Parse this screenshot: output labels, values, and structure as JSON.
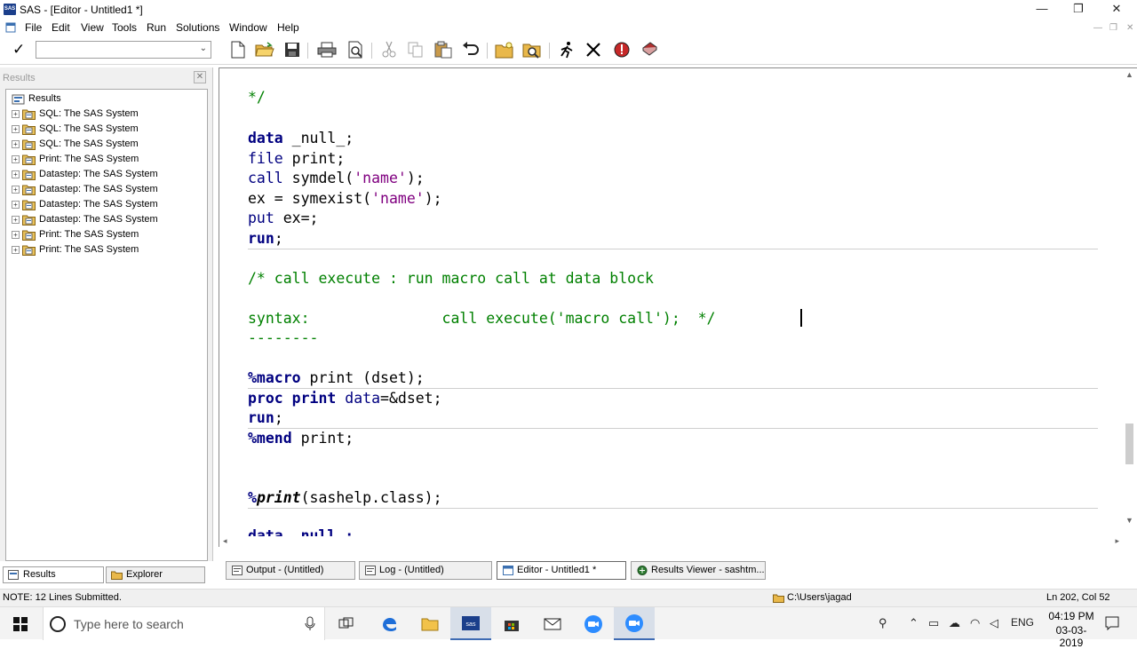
{
  "window": {
    "title": "SAS - [Editor - Untitled1 *]",
    "app_icon_label": "SAS",
    "minimize": "—",
    "restore": "❐",
    "close": "✕"
  },
  "menu": {
    "items": [
      "File",
      "Edit",
      "View",
      "Tools",
      "Run",
      "Solutions",
      "Window",
      "Help"
    ]
  },
  "toolbar": {
    "command_value": "",
    "icons": [
      "new-icon",
      "open-icon",
      "save-icon",
      "print-icon",
      "print-preview-icon",
      "cut-icon",
      "copy-icon",
      "paste-icon",
      "undo-icon",
      "new-library-icon",
      "explorer-icon",
      "submit-icon",
      "clear-icon",
      "break-icon",
      "help-icon"
    ]
  },
  "results": {
    "header": "Results",
    "close": "✕",
    "root": "Results",
    "items": [
      "SQL:  The SAS System",
      "SQL:  The SAS System",
      "SQL:  The SAS System",
      "Print:  The SAS System",
      "Datastep:  The SAS System",
      "Datastep:  The SAS System",
      "Datastep:  The SAS System",
      "Datastep:  The SAS System",
      "Print:  The SAS System",
      "Print:  The SAS System"
    ],
    "tabs": [
      "Results",
      "Explorer"
    ]
  },
  "editor": {
    "lines": {
      "l1": "*/",
      "l2_kw": "data",
      "l2_rest": " _null_;",
      "l3_kw": "file",
      "l3_rest": " print;",
      "l4_kw": "call",
      "l4_fn": " symdel",
      "l4_p": "(",
      "l4_str": "'name'",
      "l4_e": ");",
      "l5_a": "ex = ",
      "l5_fn": "symexist",
      "l5_p": "(",
      "l5_str": "'name'",
      "l5_e": ");",
      "l6_kw": "put",
      "l6_rest": " ex=;",
      "l7_kw": "run",
      "l7_rest": ";",
      "l8": "/* call execute : run macro call at data block",
      "l9": "syntax:               call execute('macro call');  */",
      "l10": "--------",
      "l11_kw": "%macro",
      "l11_rest": " print (dset);",
      "l12_kw": "proc print",
      "l12_fn": " data",
      "l12_rest": "=&dset;",
      "l13_kw": "run",
      "l13_rest": ";",
      "l14_kw": "%mend",
      "l14_rest": " print;",
      "l15_pct": "%",
      "l15_call": "print",
      "l15_rest": "(sashelp.class);",
      "l16": "data _null_;"
    }
  },
  "window_tabs": [
    "Output - (Untitled)",
    "Log - (Untitled)",
    "Editor - Untitled1 *",
    "Results Viewer - sashtm..."
  ],
  "status": {
    "note": "NOTE: 12 Lines Submitted.",
    "folder": "C:\\Users\\jagad",
    "position": "Ln 202, Col 52"
  },
  "taskbar": {
    "search_placeholder": "Type here to search",
    "language": "ENG",
    "time": "04:19 PM",
    "date": "03-03-2019"
  }
}
